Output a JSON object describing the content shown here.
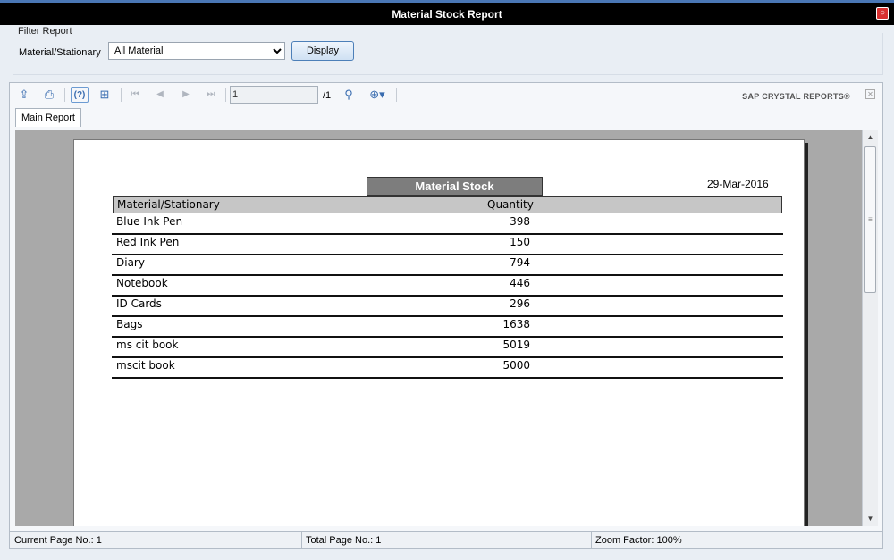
{
  "window": {
    "title": "Material Stock Report",
    "close_glyph": "⓪"
  },
  "filter": {
    "group_title": "Filter Report",
    "field_label": "Material/Stationary",
    "selected": "All Material",
    "display_label": "Display"
  },
  "toolbar": {
    "page_value": "1",
    "page_total": "/1",
    "brand": "SAP CRYSTAL REPORTS®"
  },
  "tabs": {
    "main": "Main Report"
  },
  "report": {
    "title": "Material Stock",
    "date": "29-Mar-2016",
    "col_material": "Material/Stationary",
    "col_quantity": "Quantity",
    "rows": [
      {
        "name": "Blue Ink Pen",
        "qty": "398"
      },
      {
        "name": "Red Ink Pen",
        "qty": "150"
      },
      {
        "name": "Diary",
        "qty": "794"
      },
      {
        "name": "Notebook",
        "qty": "446"
      },
      {
        "name": "ID Cards",
        "qty": "296"
      },
      {
        "name": "Bags",
        "qty": "1638"
      },
      {
        "name": "ms cit book",
        "qty": "5019"
      },
      {
        "name": "mscit book",
        "qty": "5000"
      }
    ]
  },
  "status": {
    "current_page": "Current Page No.: 1",
    "total_page": "Total Page No.: 1",
    "zoom": "Zoom Factor: 100%"
  }
}
